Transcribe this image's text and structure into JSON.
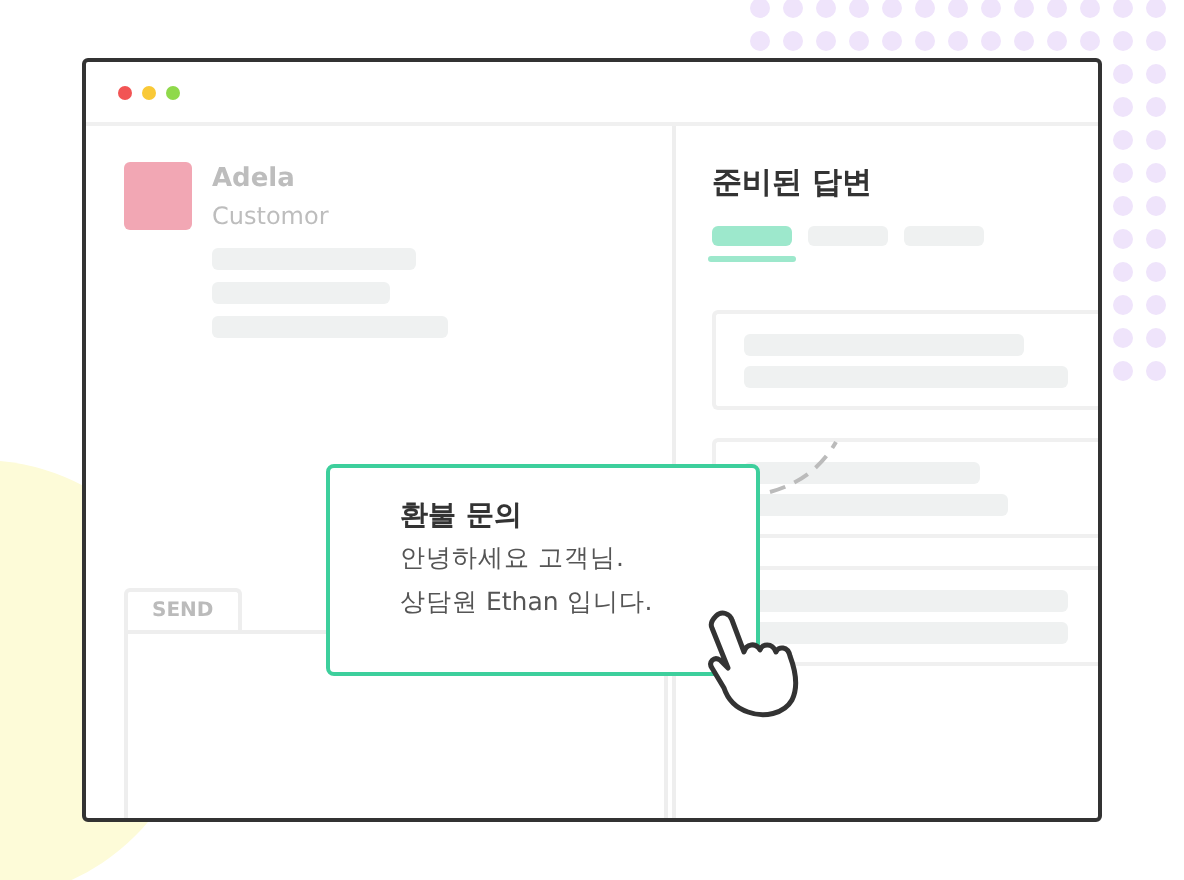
{
  "customer": {
    "name": "Adela",
    "role": "Customor"
  },
  "composer": {
    "tab": "SEND"
  },
  "replies_panel": {
    "title": "준비된 답변",
    "tabs": [
      {
        "selected": true
      },
      {
        "selected": false
      },
      {
        "selected": false
      }
    ]
  },
  "popup": {
    "title": "환불 문의",
    "lines": [
      "안녕하세요 고객님.",
      "상담원 Ethan 입니다."
    ]
  }
}
